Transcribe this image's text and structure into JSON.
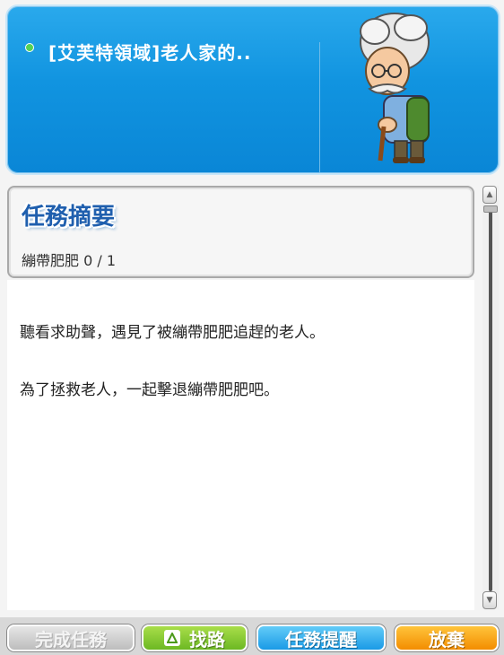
{
  "quest": {
    "title": "[艾芙特領域]老人家的..",
    "summary_heading": "任務摘要",
    "progress_text": "繃帶肥肥 0 / 1",
    "description": [
      "聽看求助聲，遇見了被繃帶肥肥追趕的老人。",
      "為了拯救老人，一起擊退繃帶肥肥吧。"
    ]
  },
  "buttons": {
    "complete": "完成任務",
    "find_path": "找路",
    "remind": "任務提醒",
    "abandon": "放棄"
  },
  "colors": {
    "header_blue": "#1194e0",
    "heading_blue": "#1f5fae",
    "find_green": "#6cb823",
    "remind_blue": "#1a9ae6",
    "abandon_orange": "#f38d00"
  },
  "icons": {
    "bullet": "green-dot-icon",
    "find": "path-arrow-icon",
    "npc": "old-man-npc-portrait"
  }
}
